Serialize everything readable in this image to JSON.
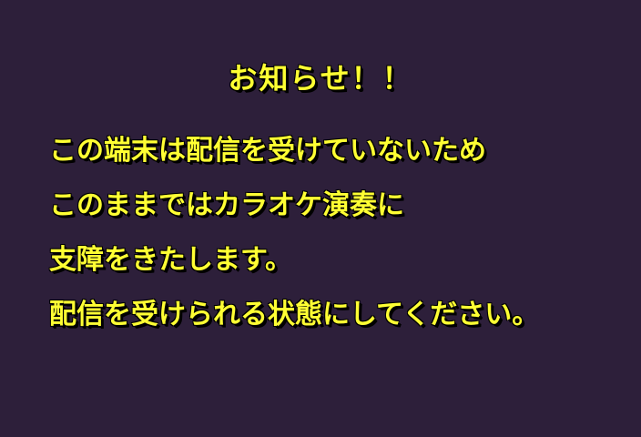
{
  "notice": {
    "title": "お知らせ！！",
    "lines": [
      "この端末は配信を受けていないため",
      "このままではカラオケ演奏に",
      "支障をきたします。",
      "配信を受けられる状態にしてください。"
    ]
  },
  "colors": {
    "background": "#2d1f3a",
    "text": "#ffff33",
    "text_outline": "#000000"
  }
}
